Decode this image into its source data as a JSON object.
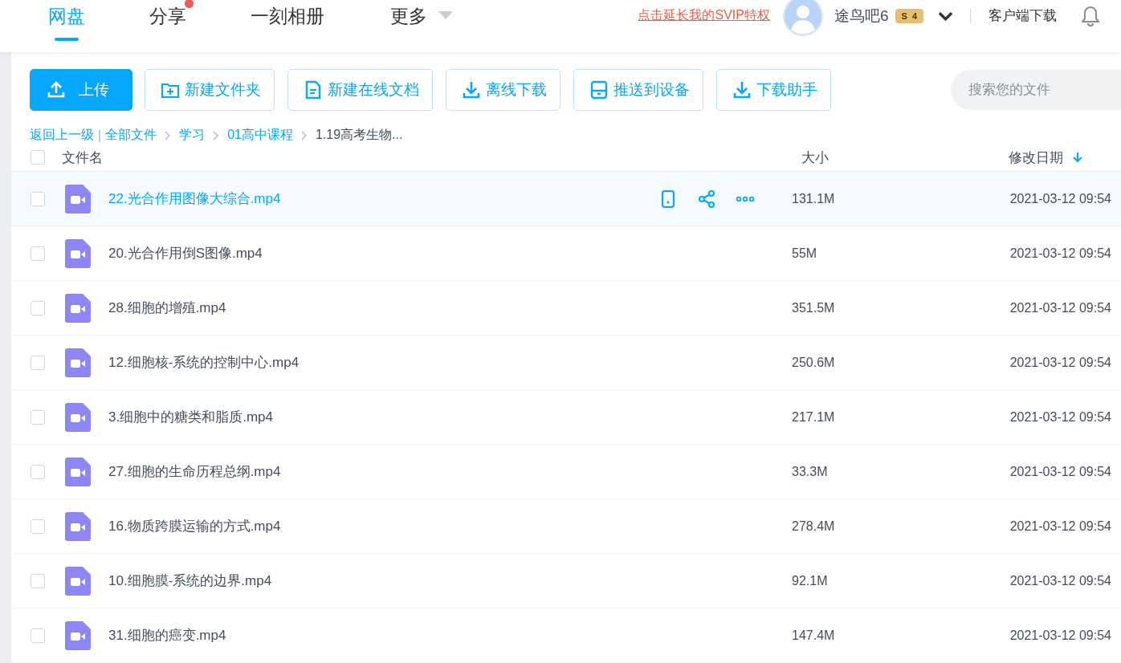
{
  "nav": {
    "tabs": [
      {
        "label": "网盘",
        "selected": true,
        "dot": false,
        "dropdown": false
      },
      {
        "label": "分享",
        "selected": false,
        "dot": true,
        "dropdown": false
      },
      {
        "label": "一刻相册",
        "selected": false,
        "dot": false,
        "dropdown": false
      },
      {
        "label": "更多",
        "selected": false,
        "dot": false,
        "dropdown": true
      }
    ],
    "promo_link": "点击延长我的SVIP特权",
    "user_name": "途鸟吧6",
    "vip_badge": {
      "letter": "S",
      "level": "4"
    },
    "client_download": "客户端下载"
  },
  "toolbar": {
    "buttons": [
      {
        "label": "上传",
        "kind": "upload",
        "primary": true
      },
      {
        "label": "新建文件夹",
        "kind": "folder",
        "primary": false
      },
      {
        "label": "新建在线文档",
        "kind": "doc",
        "primary": false
      },
      {
        "label": "离线下载",
        "kind": "download",
        "primary": false
      },
      {
        "label": "推送到设备",
        "kind": "device",
        "primary": false
      },
      {
        "label": "下载助手",
        "kind": "download",
        "primary": false
      }
    ],
    "search": {
      "placeholder": "搜索您的文件"
    }
  },
  "breadcrumb": {
    "back": "返回上一级",
    "divider": "|",
    "items": [
      {
        "label": "全部文件",
        "current": false
      },
      {
        "label": "学习",
        "current": false
      },
      {
        "label": "01高中课程",
        "current": false
      },
      {
        "label": "1.19高考生物...",
        "current": true
      }
    ]
  },
  "table": {
    "columns": [
      "文件名",
      "大小",
      "修改日期"
    ],
    "select_all": false,
    "rows": [
      {
        "name": "22.光合作用图像大综合.mp4",
        "size": "131.1M",
        "modified": "2021-03-12 09:54",
        "hovered": true,
        "checked": false
      },
      {
        "name": "20.光合作用倒S图像.mp4",
        "size": "55M",
        "modified": "2021-03-12 09:54",
        "hovered": false,
        "checked": false
      },
      {
        "name": "28.细胞的增殖.mp4",
        "size": "351.5M",
        "modified": "2021-03-12 09:54",
        "hovered": false,
        "checked": false
      },
      {
        "name": "12.细胞核-系统的控制中心.mp4",
        "size": "250.6M",
        "modified": "2021-03-12 09:54",
        "hovered": false,
        "checked": false
      },
      {
        "name": "3.细胞中的糖类和脂质.mp4",
        "size": "217.1M",
        "modified": "2021-03-12 09:54",
        "hovered": false,
        "checked": false
      },
      {
        "name": "27.细胞的生命历程总纲.mp4",
        "size": "33.3M",
        "modified": "2021-03-12 09:54",
        "hovered": false,
        "checked": false
      },
      {
        "name": "16.物质跨膜运输的方式.mp4",
        "size": "278.4M",
        "modified": "2021-03-12 09:54",
        "hovered": false,
        "checked": false
      },
      {
        "name": "10.细胞膜-系统的边界.mp4",
        "size": "92.1M",
        "modified": "2021-03-12 09:54",
        "hovered": false,
        "checked": false
      },
      {
        "name": "31.细胞的癌变.mp4",
        "size": "147.4M",
        "modified": "2021-03-12 09:54",
        "hovered": false,
        "checked": false
      }
    ]
  }
}
